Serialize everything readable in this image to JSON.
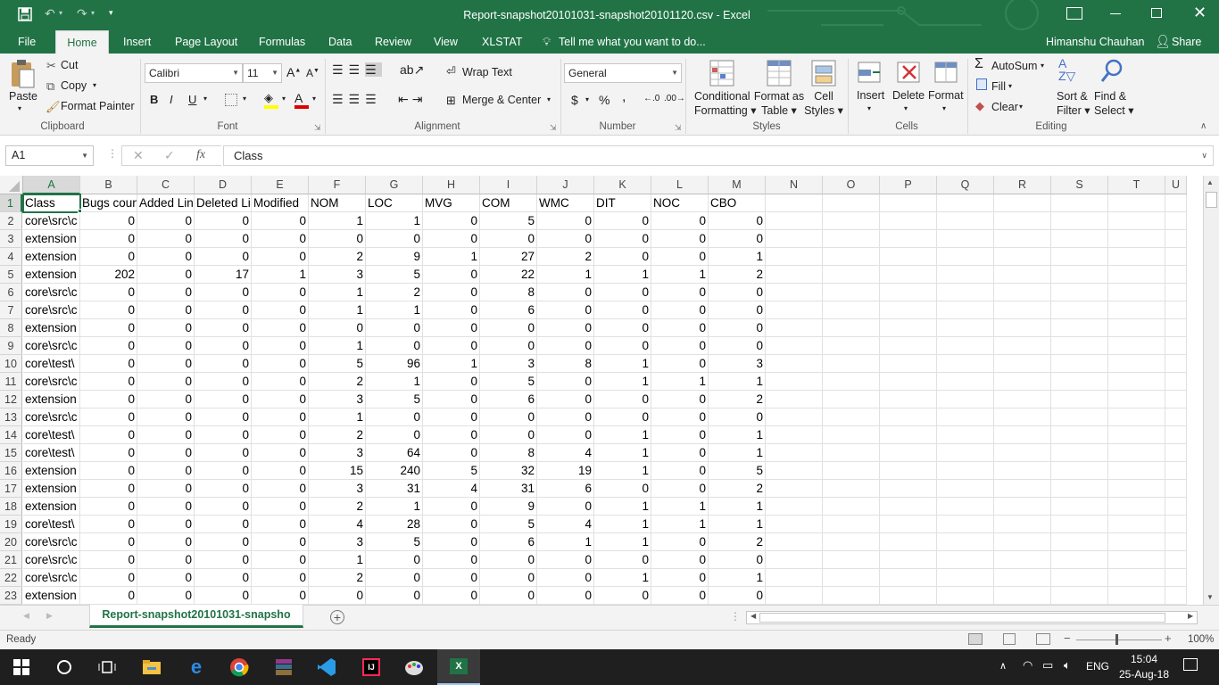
{
  "title_bar": {
    "title": "Report-snapshot20101031-snapshot20101120.csv - Excel",
    "save_icon": "save-icon",
    "undo_icon": "undo-icon",
    "redo_icon": "redo-icon",
    "customize_icon": "customize-quick-access-icon",
    "window_controls": [
      "ribbon-display-icon",
      "minimize-icon",
      "restore-icon",
      "close-icon"
    ]
  },
  "tabs": {
    "items": [
      "File",
      "Home",
      "Insert",
      "Page Layout",
      "Formulas",
      "Data",
      "Review",
      "View",
      "XLSTAT"
    ],
    "active": "Home",
    "tell_me": "Tell me what you want to do...",
    "user": "Himanshu Chauhan",
    "share": "Share"
  },
  "ribbon": {
    "clipboard": {
      "paste": "Paste",
      "cut": "Cut",
      "copy": "Copy",
      "format_painter": "Format Painter",
      "group": "Clipboard"
    },
    "font": {
      "name": "Calibri",
      "size": "11",
      "bold": "B",
      "italic": "I",
      "underline": "U",
      "group": "Font"
    },
    "alignment": {
      "wrap_text": "Wrap Text",
      "merge_center": "Merge & Center",
      "group": "Alignment"
    },
    "number": {
      "format": "General",
      "currency": "$",
      "percent": "%",
      "comma": ",",
      "group": "Number"
    },
    "styles": {
      "conditional": [
        "Conditional",
        "Formatting"
      ],
      "format_table": [
        "Format as",
        "Table"
      ],
      "cell_styles": [
        "Cell",
        "Styles"
      ],
      "group": "Styles"
    },
    "cells": {
      "insert": "Insert",
      "delete": "Delete",
      "format": "Format",
      "group": "Cells"
    },
    "editing": {
      "autosum": "AutoSum",
      "fill": "Fill",
      "clear": "Clear",
      "sort_filter": [
        "Sort &",
        "Filter"
      ],
      "find_select": [
        "Find &",
        "Select"
      ],
      "group": "Editing"
    }
  },
  "formula_bar": {
    "name_box": "A1",
    "fx": "fx",
    "content": "Class"
  },
  "sheet": {
    "columns": [
      "A",
      "B",
      "C",
      "D",
      "E",
      "F",
      "G",
      "H",
      "I",
      "J",
      "K",
      "L",
      "M",
      "N",
      "O",
      "P",
      "Q",
      "R",
      "S",
      "T",
      "U"
    ],
    "header_row": [
      "Class",
      "Bugs coun",
      "Added Lin",
      "Deleted Li",
      "Modified",
      "NOM",
      "LOC",
      "MVG",
      "COM",
      "WMC",
      "DIT",
      "NOC",
      "CBO"
    ],
    "rows": [
      [
        "core\\src\\c",
        0,
        0,
        0,
        0,
        1,
        1,
        0,
        5,
        0,
        0,
        0,
        0
      ],
      [
        "extension",
        0,
        0,
        0,
        0,
        0,
        0,
        0,
        0,
        0,
        0,
        0,
        0
      ],
      [
        "extension",
        0,
        0,
        0,
        0,
        2,
        9,
        1,
        27,
        2,
        0,
        0,
        1
      ],
      [
        "extension",
        202,
        0,
        17,
        1,
        3,
        5,
        0,
        22,
        1,
        1,
        1,
        2
      ],
      [
        "core\\src\\c",
        0,
        0,
        0,
        0,
        1,
        2,
        0,
        8,
        0,
        0,
        0,
        0
      ],
      [
        "core\\src\\c",
        0,
        0,
        0,
        0,
        1,
        1,
        0,
        6,
        0,
        0,
        0,
        0
      ],
      [
        "extension",
        0,
        0,
        0,
        0,
        0,
        0,
        0,
        0,
        0,
        0,
        0,
        0
      ],
      [
        "core\\src\\c",
        0,
        0,
        0,
        0,
        1,
        0,
        0,
        0,
        0,
        0,
        0,
        0
      ],
      [
        "core\\test\\",
        0,
        0,
        0,
        0,
        5,
        96,
        1,
        3,
        8,
        1,
        0,
        3
      ],
      [
        "core\\src\\c",
        0,
        0,
        0,
        0,
        2,
        1,
        0,
        5,
        0,
        1,
        1,
        1
      ],
      [
        "extension",
        0,
        0,
        0,
        0,
        3,
        5,
        0,
        6,
        0,
        0,
        0,
        2
      ],
      [
        "core\\src\\c",
        0,
        0,
        0,
        0,
        1,
        0,
        0,
        0,
        0,
        0,
        0,
        0
      ],
      [
        "core\\test\\",
        0,
        0,
        0,
        0,
        2,
        0,
        0,
        0,
        0,
        1,
        0,
        1
      ],
      [
        "core\\test\\",
        0,
        0,
        0,
        0,
        3,
        64,
        0,
        8,
        4,
        1,
        0,
        1
      ],
      [
        "extension",
        0,
        0,
        0,
        0,
        15,
        240,
        5,
        32,
        19,
        1,
        0,
        5
      ],
      [
        "extension",
        0,
        0,
        0,
        0,
        3,
        31,
        4,
        31,
        6,
        0,
        0,
        2
      ],
      [
        "extension",
        0,
        0,
        0,
        0,
        2,
        1,
        0,
        9,
        0,
        1,
        1,
        1
      ],
      [
        "core\\test\\",
        0,
        0,
        0,
        0,
        4,
        28,
        0,
        5,
        4,
        1,
        1,
        1
      ],
      [
        "core\\src\\c",
        0,
        0,
        0,
        0,
        3,
        5,
        0,
        6,
        1,
        1,
        0,
        2
      ],
      [
        "core\\src\\c",
        0,
        0,
        0,
        0,
        1,
        0,
        0,
        0,
        0,
        0,
        0,
        0
      ],
      [
        "core\\src\\c",
        0,
        0,
        0,
        0,
        2,
        0,
        0,
        0,
        0,
        1,
        0,
        1
      ],
      [
        "extension",
        0,
        0,
        0,
        0,
        0,
        0,
        0,
        0,
        0,
        0,
        0,
        0
      ]
    ],
    "row_numbers": [
      "1",
      "2",
      "3",
      "4",
      "5",
      "6",
      "7",
      "8",
      "9",
      "10",
      "11",
      "12",
      "13",
      "14",
      "15",
      "16",
      "17",
      "18",
      "19",
      "20",
      "21",
      "22",
      "23"
    ],
    "tab_name": "Report-snapshot20101031-snapsho"
  },
  "status_bar": {
    "ready": "Ready",
    "zoom": "100%"
  },
  "taskbar": {
    "apps": [
      "start-icon",
      "cortana-icon",
      "task-view-icon",
      "file-explorer-icon",
      "edge-icon",
      "chrome-icon",
      "winrar-icon",
      "vscode-icon",
      "intellij-icon",
      "paint-icon",
      "excel-icon"
    ],
    "language": "ENG",
    "time": "15:04",
    "date": "25-Aug-18"
  }
}
